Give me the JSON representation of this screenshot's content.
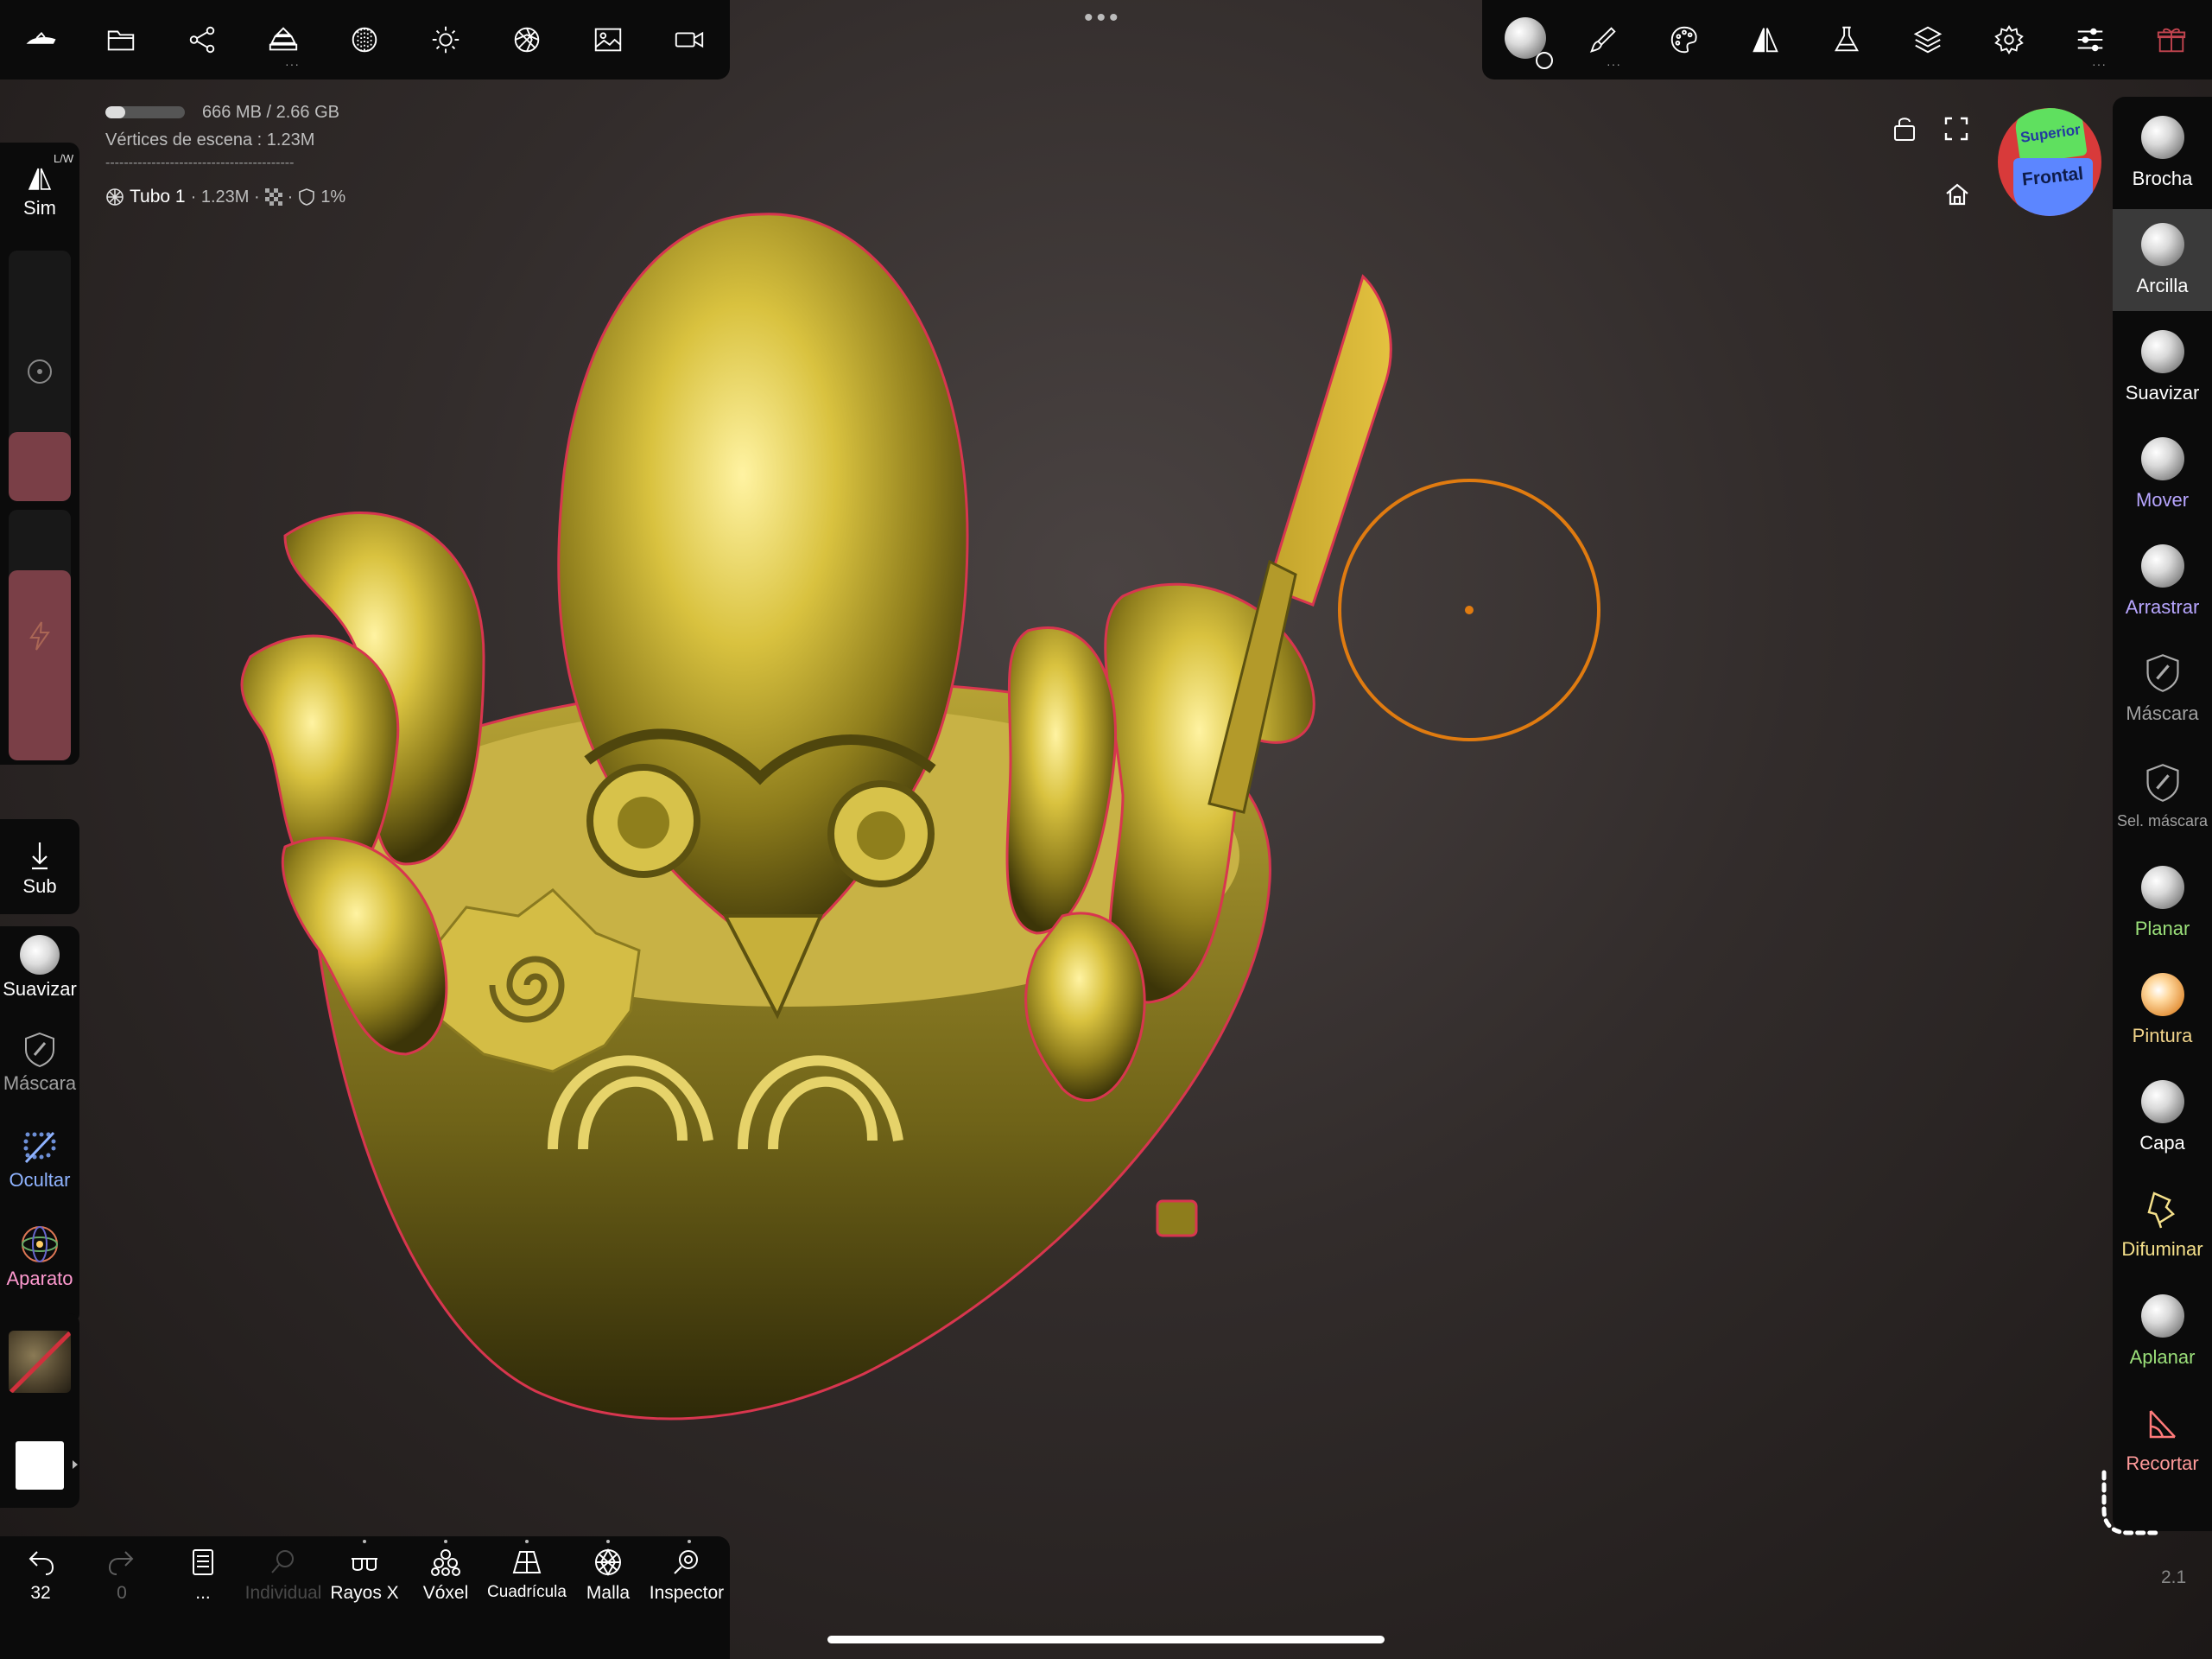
{
  "top_toolbar_left": {
    "icons": [
      "sculpt-icon",
      "folder-icon",
      "share-icon",
      "scene-tree-icon",
      "background-icon",
      "light-icon",
      "material-icon",
      "image-icon",
      "camera-icon"
    ]
  },
  "top_center": {
    "menu_dots": "•••"
  },
  "top_toolbar_right": {
    "icons": [
      "material-sphere-icon",
      "brush-icon",
      "palette-icon",
      "symmetry-icon",
      "flask-icon",
      "layers-icon",
      "settings-icon",
      "sliders-icon",
      "gift-icon"
    ]
  },
  "stats": {
    "memory": "666 MB / 2.66 GB",
    "memory_fraction": 0.25,
    "vertices": "Vértices de escena : 1.23M",
    "separator": "-----------------------------------------",
    "object_name": "Tubo 1",
    "object_verts": "· 1.23M ·",
    "object_percent": "1%"
  },
  "left_sidebar": {
    "sym_label": "Sim",
    "sym_badge": "L/W",
    "sub_label": "Sub",
    "tools": [
      {
        "label": "Suavizar",
        "color": "#ffffff"
      },
      {
        "label": "Máscara",
        "color": "#a0a0a0"
      },
      {
        "label": "Ocultar",
        "color": "#8fb3ff"
      },
      {
        "label": "Aparato",
        "color": "#ff9ad0"
      }
    ]
  },
  "right_tools": [
    {
      "label": "Brocha",
      "color": "#ffffff"
    },
    {
      "label": "Arcilla",
      "color": "#ffffff"
    },
    {
      "label": "Suavizar",
      "color": "#ffffff"
    },
    {
      "label": "Mover",
      "color": "#b8a6ff"
    },
    {
      "label": "Arrastrar",
      "color": "#b8a6ff"
    },
    {
      "label": "Máscara",
      "color": "#a0a0a0"
    },
    {
      "label": "Sel. máscara",
      "color": "#a0a0a0"
    },
    {
      "label": "Planar",
      "color": "#9be07a"
    },
    {
      "label": "Pintura",
      "color": "#f0d38a"
    },
    {
      "label": "Capa",
      "color": "#ffffff"
    },
    {
      "label": "Difuminar",
      "color": "#f5e08a"
    },
    {
      "label": "Aplanar",
      "color": "#9be07a"
    },
    {
      "label": "Recortar",
      "color": "#ff9a9a"
    }
  ],
  "gizmo": {
    "top": "Superior",
    "front": "Frontal"
  },
  "bottom_bar": {
    "undo_count": "32",
    "redo_count": "0",
    "tools": [
      {
        "label": "...",
        "enabled": true
      },
      {
        "label": "Individual",
        "enabled": false
      },
      {
        "label": "Rayos X",
        "enabled": true
      },
      {
        "label": "Vóxel",
        "enabled": true
      },
      {
        "label": "Cuadrícula",
        "enabled": true
      },
      {
        "label": "Malla",
        "enabled": true
      },
      {
        "label": "Inspector",
        "enabled": true
      }
    ]
  },
  "version": "2.1",
  "colors": {
    "panel": "#0b0b0b",
    "brush_circle": "#e07b10",
    "outline": "#d8364f",
    "model_gold": "#c9b330"
  }
}
